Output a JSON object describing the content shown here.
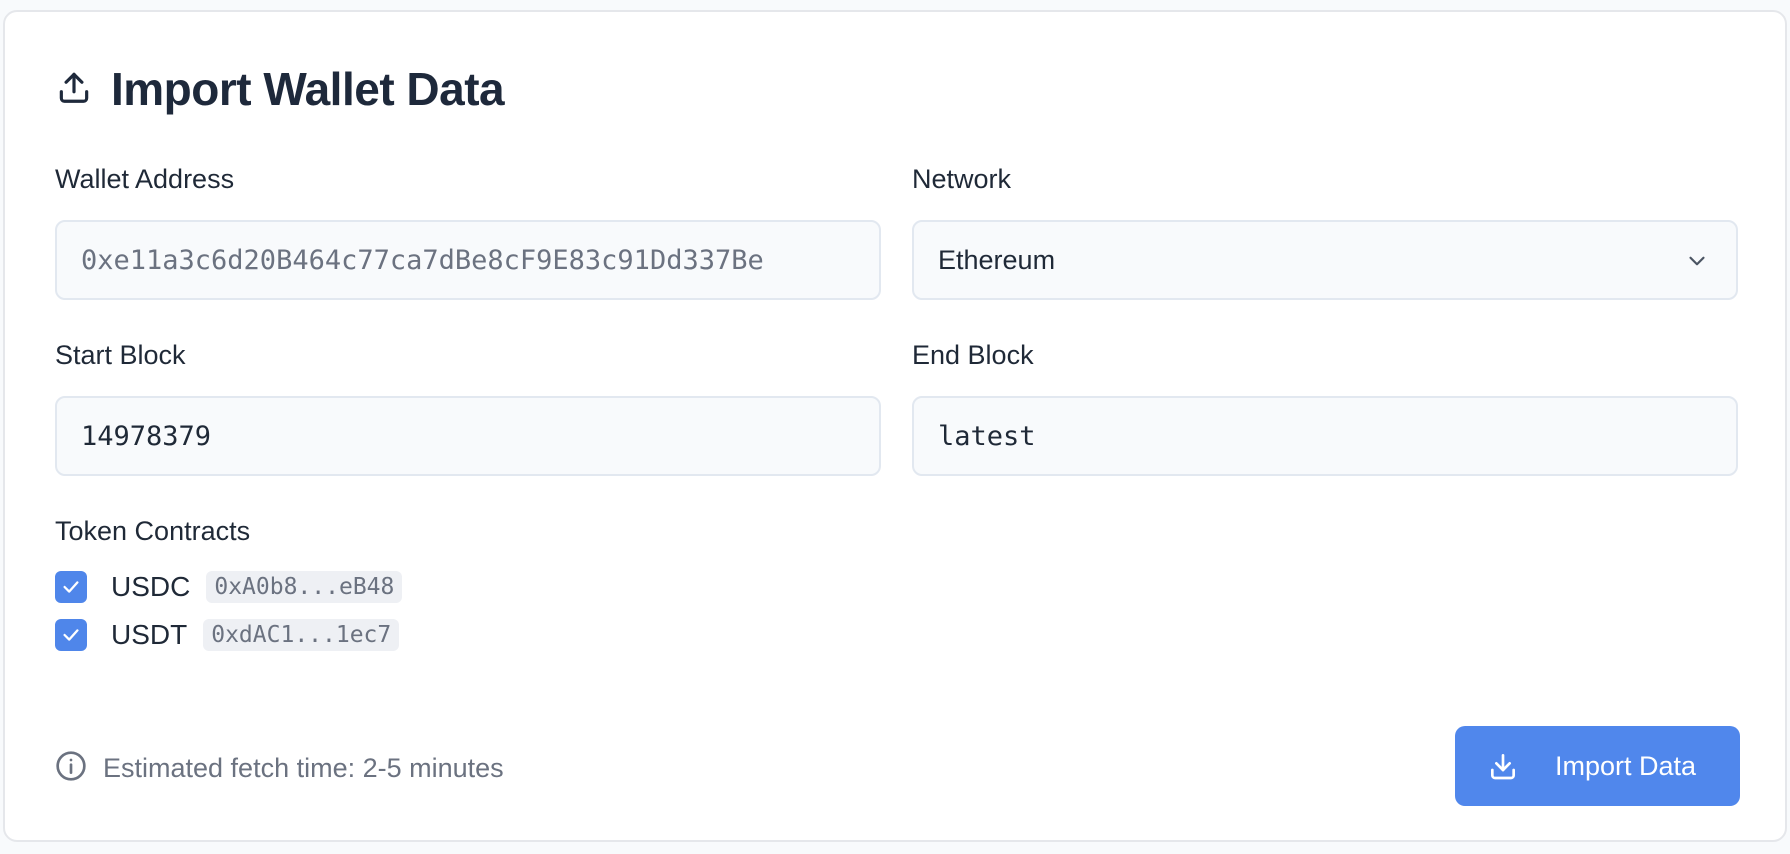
{
  "header": {
    "title": "Import Wallet Data",
    "icon": "upload-icon"
  },
  "form": {
    "wallet_address": {
      "label": "Wallet Address",
      "placeholder": "0xe11a3c6d20B464c77ca7dBe8cF9E83c91Dd337Be"
    },
    "network": {
      "label": "Network",
      "selected": "Ethereum"
    },
    "start_block": {
      "label": "Start Block",
      "value": "14978379"
    },
    "end_block": {
      "label": "End Block",
      "value": "latest"
    },
    "token_contracts": {
      "label": "Token Contracts",
      "items": [
        {
          "name": "USDC",
          "address": "0xA0b8...eB48",
          "checked": true
        },
        {
          "name": "USDT",
          "address": "0xdAC1...1ec7",
          "checked": true
        }
      ]
    }
  },
  "footer": {
    "info_text": "Estimated fetch time: 2-5 minutes",
    "import_button": "Import Data"
  },
  "colors": {
    "accent": "#5087ec",
    "muted_text": "#6b7280",
    "input_bg": "#f8fafc",
    "border": "#e2e8f0"
  }
}
